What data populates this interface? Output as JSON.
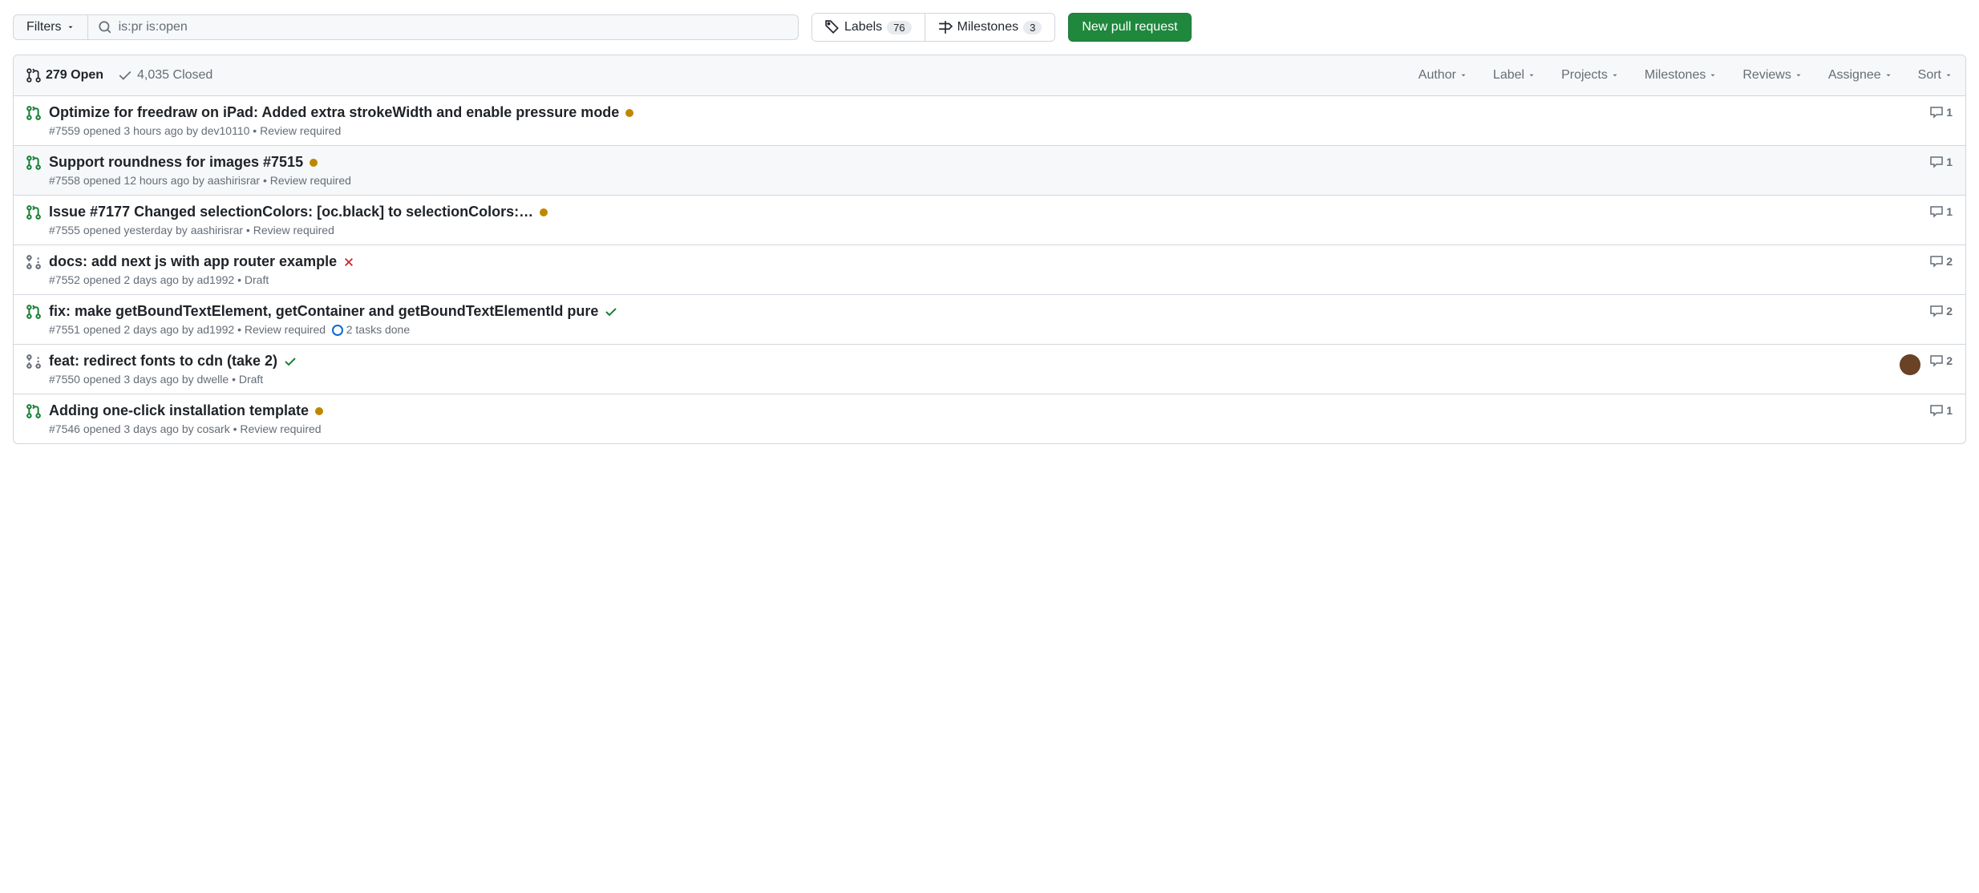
{
  "topbar": {
    "filters_label": "Filters",
    "search_value": "is:pr is:open",
    "labels_label": "Labels",
    "labels_count": "76",
    "milestones_label": "Milestones",
    "milestones_count": "3",
    "new_pr_label": "New pull request"
  },
  "header": {
    "open_count": "279 Open",
    "closed_count": "4,035 Closed",
    "filters": {
      "author": "Author",
      "label": "Label",
      "projects": "Projects",
      "milestones": "Milestones",
      "reviews": "Reviews",
      "assignee": "Assignee",
      "sort": "Sort"
    }
  },
  "rows": [
    {
      "state": "open",
      "title": "Optimize for freedraw on iPad: Added extra strokeWidth and enable pressure mode",
      "status": "dot",
      "meta": "#7559 opened 3 hours ago by dev10110 • Review required",
      "comments": "1"
    },
    {
      "state": "open",
      "hovered": true,
      "title": "Support roundness for images #7515",
      "status": "dot",
      "meta": "#7558 opened 12 hours ago by aashirisrar • Review required",
      "comments": "1"
    },
    {
      "state": "open",
      "title": "Issue #7177 Changed selectionColors: [oc.black] to selectionColors:…",
      "status": "dot",
      "meta": "#7555 opened yesterday by aashirisrar • Review required",
      "comments": "1"
    },
    {
      "state": "draft",
      "title": "docs: add next js with app router example",
      "status": "x",
      "meta": "#7552 opened 2 days ago by ad1992 • Draft",
      "comments": "2"
    },
    {
      "state": "open",
      "title": "fix: make getBoundTextElement, getContainer and getBoundTextElementId pure",
      "status": "check",
      "meta": "#7551 opened 2 days ago by ad1992 • Review required",
      "tasks": "2 tasks done",
      "comments": "2"
    },
    {
      "state": "draft",
      "title": "feat: redirect fonts to cdn (take 2)",
      "status": "check",
      "meta": "#7550 opened 3 days ago by dwelle • Draft",
      "has_avatar": true,
      "comments": "2"
    },
    {
      "state": "open",
      "title": "Adding one-click installation template",
      "status": "dot",
      "meta": "#7546 opened 3 days ago by cosark • Review required",
      "comments": "1"
    }
  ]
}
